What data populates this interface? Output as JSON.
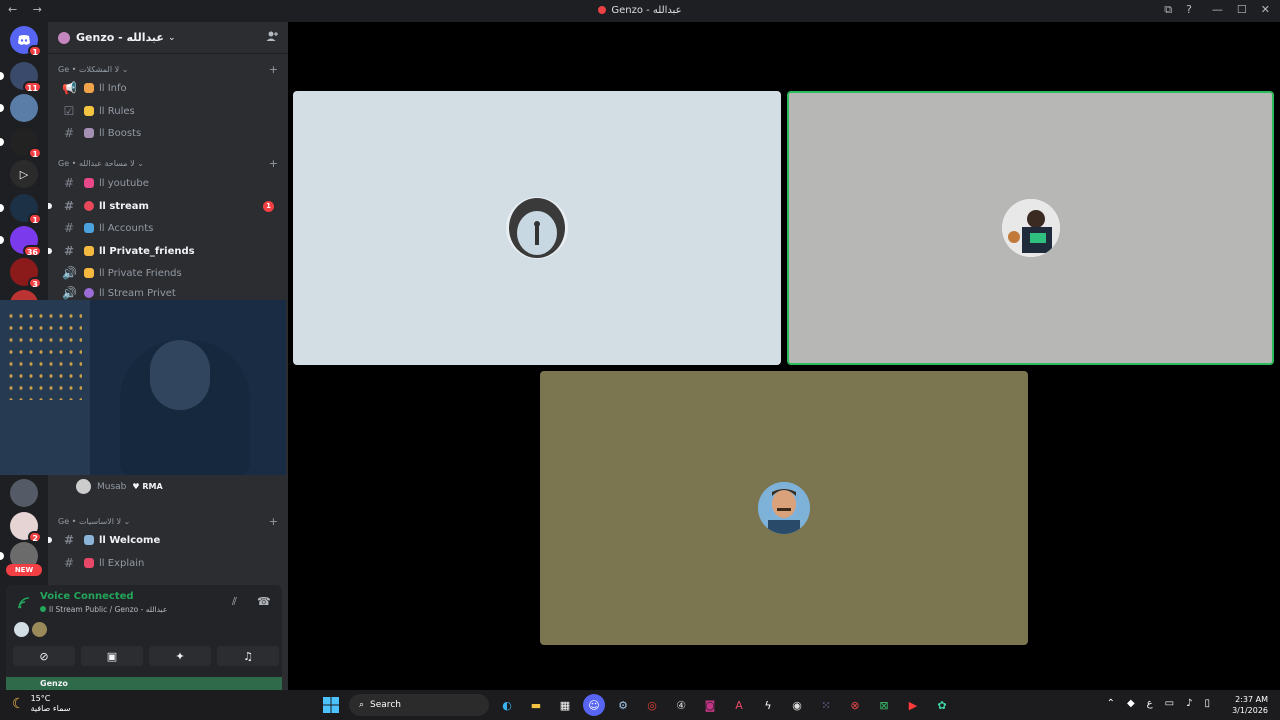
{
  "window": {
    "title": "Genzo - عبدالله",
    "nav_icons": "← →",
    "controls": [
      "—",
      "☐",
      "✕"
    ],
    "extra_icons": [
      "⧉",
      "?"
    ]
  },
  "server": {
    "name": "Genzo - عبدالله",
    "chevron": "⌄"
  },
  "rail": {
    "badges": [
      "1",
      "11",
      "1",
      "1",
      "36",
      "3",
      "2"
    ],
    "new_label": "NEW"
  },
  "categories": [
    {
      "label": "Ge • لا المشكلات ⌄"
    },
    {
      "label": "Ge • لا مساحة عبدالله ⌄"
    },
    {
      "label": "Ge • لا الاساسيات ⌄"
    }
  ],
  "channels": [
    {
      "label": "ll Info"
    },
    {
      "label": "ll Rules"
    },
    {
      "label": "ll Boosts"
    },
    {
      "label": "ll youtube"
    },
    {
      "label": "ll stream",
      "unread": "1"
    },
    {
      "label": "ll Accounts"
    },
    {
      "label": "ll Private_friends"
    },
    {
      "label": "ll Private Friends"
    },
    {
      "label": "ll Stream Privet"
    },
    {
      "label": "ll Welcome"
    },
    {
      "label": "ll Explain"
    }
  ],
  "voice_member": {
    "name": "Musab",
    "tag": "RMA"
  },
  "voice_panel": {
    "status": "Voice Connected",
    "subtitle": "ll Stream Public / Genzo - عبدالله"
  },
  "user": {
    "name": "Genzo"
  },
  "taskbar": {
    "temperature": "15°C",
    "weather_desc": "سماء صافية",
    "search_label": "Search",
    "time": "2:37 AM",
    "date": "3/1/2026",
    "lang": "ع"
  },
  "colors": {
    "tile_1": "#d2dde4",
    "tile_2": "#b7b8b6",
    "tile_3": "#7b7550",
    "speaking_border": "#2dbb5c",
    "voice_green": "#23a55a"
  }
}
